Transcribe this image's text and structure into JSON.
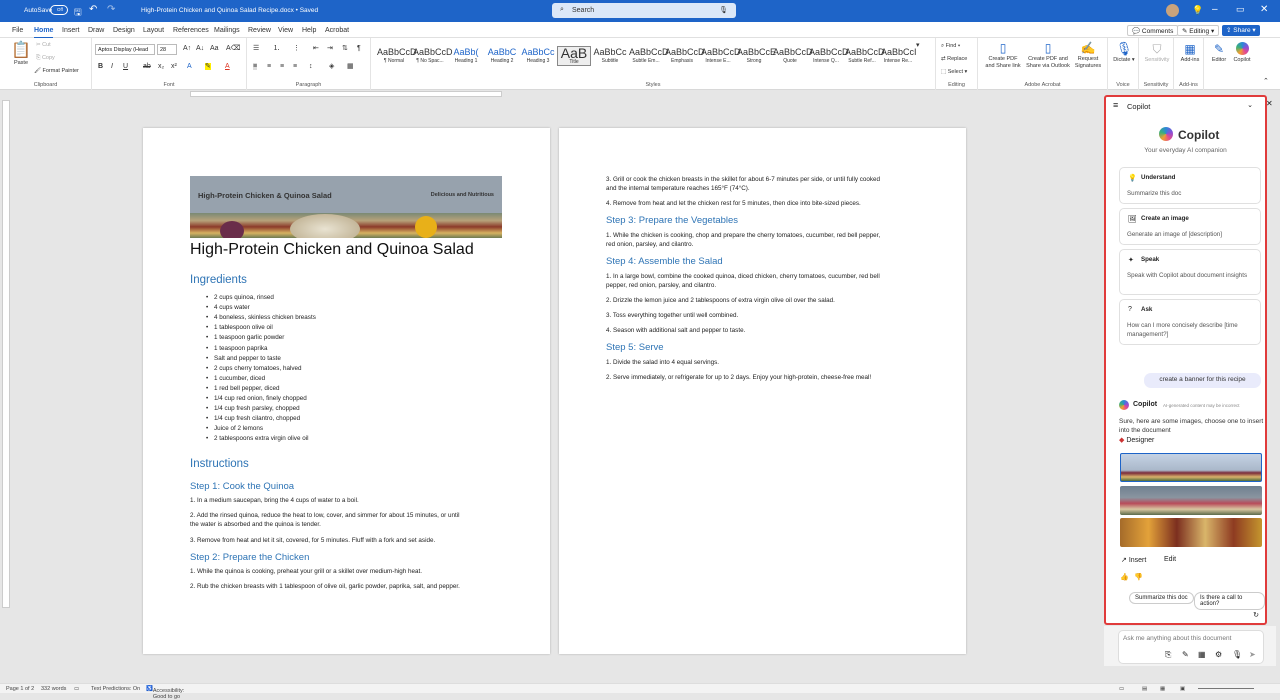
{
  "titlebar": {
    "autosave": "AutoSave",
    "autosave_state": "Off",
    "doc_title": "High-Protein Chicken and Quinoa Salad Recipe.docx • Saved",
    "search_placeholder": "Search"
  },
  "menubar": {
    "tabs": [
      "File",
      "Home",
      "Insert",
      "Draw",
      "Design",
      "Layout",
      "References",
      "Mailings",
      "Review",
      "View",
      "Help",
      "Acrobat"
    ],
    "comments": "Comments",
    "editing": "Editing",
    "share": "Share"
  },
  "ribbon": {
    "paste": "Paste",
    "cut": "Cut",
    "copy": "Copy",
    "format_painter": "Format Painter",
    "clipboard": "Clipboard",
    "font_name": "Aptos Display (Head",
    "font_size": "28",
    "font": "Font",
    "paragraph": "Paragraph",
    "styles_label": "Styles",
    "styles": [
      {
        "p": "AaBbCcD",
        "n": "¶ Normal"
      },
      {
        "p": "AaBbCcD",
        "n": "¶ No Spac..."
      },
      {
        "p": "AaBb(",
        "n": "Heading 1"
      },
      {
        "p": "AaBbC",
        "n": "Heading 2"
      },
      {
        "p": "AaBbCc",
        "n": "Heading 3"
      },
      {
        "p": "AaB",
        "n": "Title"
      },
      {
        "p": "AaBbCc",
        "n": "Subtitle"
      },
      {
        "p": "AaBbCcD",
        "n": "Subtle Em..."
      },
      {
        "p": "AaBbCcD",
        "n": "Emphasis"
      },
      {
        "p": "AaBbCcD",
        "n": "Intense E..."
      },
      {
        "p": "AaBbCcE",
        "n": "Strong"
      },
      {
        "p": "AaBbCcD",
        "n": "Quote"
      },
      {
        "p": "AaBbCcD",
        "n": "Intense Q..."
      },
      {
        "p": "AaBbCcD",
        "n": "Subtle Ref..."
      },
      {
        "p": "AaBbCcI",
        "n": "Intense Re..."
      }
    ],
    "find": "Find",
    "replace": "Replace",
    "select": "Select",
    "editing": "Editing",
    "create_pdf": "Create PDF and Share link",
    "create_pdf_outlook": "Create PDF and Share via Outlook",
    "request_sig": "Request Signatures",
    "adobe": "Adobe Acrobat",
    "dictate": "Dictate",
    "sensitivity": "Sensitivity",
    "addins": "Add-ins",
    "editor": "Editor",
    "copilot": "Copilot",
    "voice": "Voice",
    "sensitivity_grp": "Sensitivity",
    "addins_grp": "Add-ins"
  },
  "doc": {
    "banner_title": "High-Protein Chicken & Quinoa Salad",
    "banner_sub": "Delicious and Nutritious",
    "title": "High-Protein Chicken and Quinoa Salad",
    "ingredients_h": "Ingredients",
    "ingredients": [
      "2 cups quinoa, rinsed",
      "4 cups water",
      "4 boneless, skinless chicken breasts",
      "1 tablespoon olive oil",
      "1 teaspoon garlic powder",
      "1 teaspoon paprika",
      "Salt and pepper to taste",
      "2 cups cherry tomatoes, halved",
      "1 cucumber, diced",
      "1 red bell pepper, diced",
      "1/4 cup red onion, finely chopped",
      "1/4 cup fresh parsley, chopped",
      "1/4 cup fresh cilantro, chopped",
      "Juice of 2 lemons",
      "2 tablespoons extra virgin olive oil"
    ],
    "instructions_h": "Instructions",
    "step1_h": "Step 1: Cook the Quinoa",
    "step1": [
      "1. In a medium saucepan, bring the 4 cups of water to a boil.",
      "2. Add the rinsed quinoa, reduce the heat to low, cover, and simmer for about 15 minutes, or until",
      "the water is absorbed and the quinoa is tender.",
      "3. Remove from heat and let it sit, covered, for 5 minutes. Fluff with a fork and set aside."
    ],
    "step2_h": "Step 2: Prepare the Chicken",
    "step2": [
      "1. While the quinoa is cooking, preheat your grill or a skillet over medium-high heat.",
      "2. Rub the chicken breasts with 1 tablespoon of olive oil, garlic powder, paprika, salt, and pepper."
    ],
    "p2": [
      "3. Grill or cook the chicken breasts in the skillet for about 6-7 minutes per side, or until fully cooked",
      "and the internal temperature reaches 165°F (74°C).",
      "4. Remove from heat and let the chicken rest for 5 minutes, then dice into bite-sized pieces."
    ],
    "step3_h": "Step 3: Prepare the Vegetables",
    "step3": [
      "1. While the chicken is cooking, chop and prepare the cherry tomatoes, cucumber, red bell pepper,",
      "red onion, parsley, and cilantro."
    ],
    "step4_h": "Step 4: Assemble the Salad",
    "step4": [
      "1. In a large bowl, combine the cooked quinoa, diced chicken, cherry tomatoes, cucumber, red bell",
      "pepper, red onion, parsley, and cilantro.",
      "2. Drizzle the lemon juice and 2 tablespoons of extra virgin olive oil over the salad.",
      "3. Toss everything together until well combined.",
      "4. Season with additional salt and pepper to taste."
    ],
    "step5_h": "Step 5: Serve",
    "step5": [
      "1. Divide the salad into 4 equal servings.",
      "2. Serve immediately, or refrigerate for up to 2 days. Enjoy your high-protein, cheese-free meal!"
    ]
  },
  "copilot": {
    "pane_title": "Copilot",
    "logo": "Copilot",
    "tagline": "Your everyday AI companion",
    "cards": [
      {
        "t": "Understand",
        "d": "Summarize this doc"
      },
      {
        "t": "Create an image",
        "d": "Generate an image of [description]"
      },
      {
        "t": "Speak",
        "d": "Speak with Copilot about document insights"
      },
      {
        "t": "Ask",
        "d": "How can I more concisely describe [time management?]"
      }
    ],
    "user_msg": "create a banner for this recipe",
    "resp_name": "Copilot",
    "resp_note": "AI-generated content may be incorrect",
    "resp_text": "Sure, here are some images, choose one to insert into the document",
    "designer": "Designer",
    "insert": "Insert",
    "edit": "Edit",
    "sugg1": "Summarize this doc",
    "sugg2": "Is there a call to action?",
    "input_placeholder": "Ask me anything about this document"
  },
  "status": {
    "page": "Page 1 of 2",
    "words": "332 words",
    "predictions": "Text Predictions: On",
    "accessibility": "Accessibility: Good to go"
  }
}
